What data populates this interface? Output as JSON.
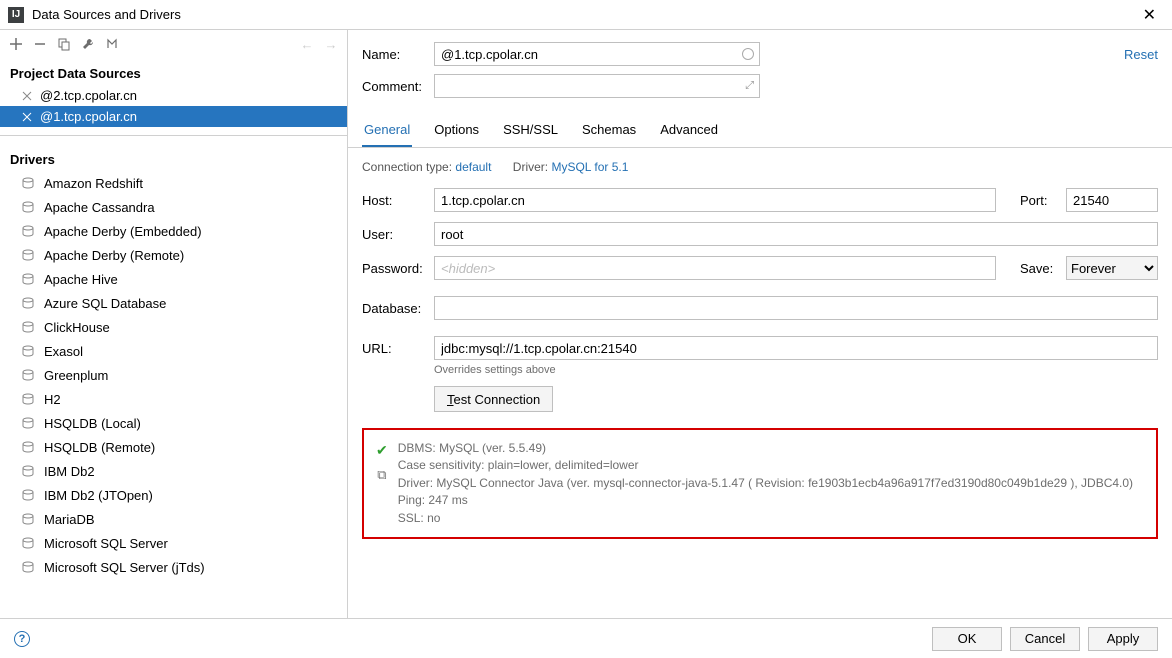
{
  "window": {
    "title": "Data Sources and Drivers"
  },
  "toolbar": {
    "add": "+",
    "remove": "−",
    "copy": "⧉",
    "wrench": "🔧",
    "reset_layout": "↙"
  },
  "sidebar": {
    "project_header": "Project Data Sources",
    "data_sources": [
      {
        "label": "@2.tcp.cpolar.cn",
        "selected": false
      },
      {
        "label": "@1.tcp.cpolar.cn",
        "selected": true
      }
    ],
    "drivers_header": "Drivers",
    "drivers": [
      "Amazon Redshift",
      "Apache Cassandra",
      "Apache Derby (Embedded)",
      "Apache Derby (Remote)",
      "Apache Hive",
      "Azure SQL Database",
      "ClickHouse",
      "Exasol",
      "Greenplum",
      "H2",
      "HSQLDB (Local)",
      "HSQLDB (Remote)",
      "IBM Db2",
      "IBM Db2 (JTOpen)",
      "MariaDB",
      "Microsoft SQL Server",
      "Microsoft SQL Server (jTds)"
    ]
  },
  "form": {
    "name_label": "Name:",
    "name_value": "@1.tcp.cpolar.cn",
    "comment_label": "Comment:",
    "comment_value": "",
    "reset_label": "Reset",
    "tabs": [
      "General",
      "Options",
      "SSH/SSL",
      "Schemas",
      "Advanced"
    ],
    "active_tab": 0,
    "connection_type_label": "Connection type:",
    "connection_type_value": "default",
    "driver_label": "Driver:",
    "driver_value": "MySQL for 5.1",
    "host_label": "Host:",
    "host_value": "1.tcp.cpolar.cn",
    "port_label": "Port:",
    "port_value": "21540",
    "user_label": "User:",
    "user_value": "root",
    "password_label": "Password:",
    "password_placeholder": "<hidden>",
    "save_label": "Save:",
    "save_value": "Forever",
    "database_label": "Database:",
    "database_value": "",
    "url_label": "URL:",
    "url_value": "jdbc:mysql://1.tcp.cpolar.cn:21540",
    "url_note": "Overrides settings above",
    "test_label": "Test Connection"
  },
  "result": {
    "line1": "DBMS: MySQL (ver. 5.5.49)",
    "line2": "Case sensitivity: plain=lower, delimited=lower",
    "line3": "Driver: MySQL Connector Java (ver. mysql-connector-java-5.1.47 ( Revision: fe1903b1ecb4a96a917f7ed3190d80c049b1de29 ), JDBC4.0)",
    "line4": "Ping: 247 ms",
    "line5": "SSL: no"
  },
  "buttons": {
    "ok": "OK",
    "cancel": "Cancel",
    "apply": "Apply"
  }
}
